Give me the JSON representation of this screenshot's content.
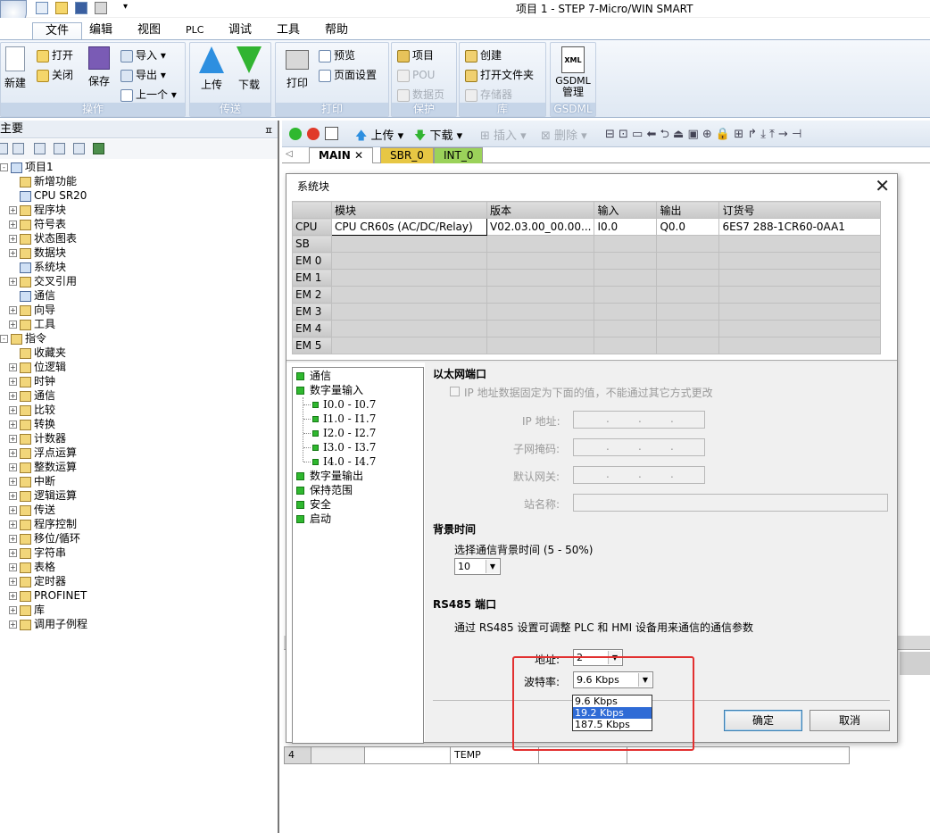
{
  "window": {
    "title": "项目 1 - STEP 7-Micro/WIN SMART"
  },
  "ribbon_tabs": [
    "文件",
    "编辑",
    "视图",
    "PLC",
    "调试",
    "工具",
    "帮助"
  ],
  "ribbon": {
    "ops": {
      "new": "新建",
      "open": "打开",
      "close": "关闭",
      "save": "保存",
      "import": "导入",
      "export": "导出",
      "prev": "上一个",
      "label": "操作"
    },
    "transfer": {
      "upload": "上传",
      "download": "下载",
      "label": "传送"
    },
    "print": {
      "print": "打印",
      "preview": "预览",
      "page_setup": "页面设置",
      "label": "打印"
    },
    "protect": {
      "project": "项目",
      "pou": "POU",
      "datapage": "数据页",
      "label": "保护"
    },
    "lib": {
      "create": "创建",
      "open_folder": "打开文件夹",
      "memory": "存储器",
      "label": "库"
    },
    "gsdml": {
      "line1": "GSDML",
      "line2": "管理",
      "label": "GSDML",
      "icon_text": "XML"
    }
  },
  "left_panel": {
    "title": "主要",
    "tree": [
      {
        "label": "项目1",
        "level": 0,
        "pm": "-"
      },
      {
        "label": "新增功能",
        "level": 1
      },
      {
        "label": "CPU SR20",
        "level": 1
      },
      {
        "label": "程序块",
        "level": 1,
        "pm": "+"
      },
      {
        "label": "符号表",
        "level": 1,
        "pm": "+"
      },
      {
        "label": "状态图表",
        "level": 1,
        "pm": "+"
      },
      {
        "label": "数据块",
        "level": 1,
        "pm": "+"
      },
      {
        "label": "系统块",
        "level": 1
      },
      {
        "label": "交叉引用",
        "level": 1,
        "pm": "+"
      },
      {
        "label": "通信",
        "level": 1
      },
      {
        "label": "向导",
        "level": 1,
        "pm": "+"
      },
      {
        "label": "工具",
        "level": 1,
        "pm": "+"
      },
      {
        "label": "指令",
        "level": 0,
        "pm": "-"
      },
      {
        "label": "收藏夹",
        "level": 1
      },
      {
        "label": "位逻辑",
        "level": 1,
        "pm": "+"
      },
      {
        "label": "时钟",
        "level": 1,
        "pm": "+"
      },
      {
        "label": "通信",
        "level": 1,
        "pm": "+"
      },
      {
        "label": "比较",
        "level": 1,
        "pm": "+"
      },
      {
        "label": "转换",
        "level": 1,
        "pm": "+"
      },
      {
        "label": "计数器",
        "level": 1,
        "pm": "+"
      },
      {
        "label": "浮点运算",
        "level": 1,
        "pm": "+"
      },
      {
        "label": "整数运算",
        "level": 1,
        "pm": "+"
      },
      {
        "label": "中断",
        "level": 1,
        "pm": "+"
      },
      {
        "label": "逻辑运算",
        "level": 1,
        "pm": "+"
      },
      {
        "label": "传送",
        "level": 1,
        "pm": "+"
      },
      {
        "label": "程序控制",
        "level": 1,
        "pm": "+"
      },
      {
        "label": "移位/循环",
        "level": 1,
        "pm": "+"
      },
      {
        "label": "字符串",
        "level": 1,
        "pm": "+"
      },
      {
        "label": "表格",
        "level": 1,
        "pm": "+"
      },
      {
        "label": "定时器",
        "level": 1,
        "pm": "+"
      },
      {
        "label": "PROFINET",
        "level": 1,
        "pm": "+"
      },
      {
        "label": "库",
        "level": 1,
        "pm": "+"
      },
      {
        "label": "调用子例程",
        "level": 1,
        "pm": "+"
      }
    ]
  },
  "editor": {
    "toolbar": {
      "upload": "上传",
      "download": "下载",
      "insert": "插入",
      "delete": "删除"
    },
    "tabs": [
      "MAIN",
      "SBR_0",
      "INT_0"
    ],
    "bg_row": {
      "num": "4",
      "name": "TEMP"
    }
  },
  "dialog": {
    "title": "系统块",
    "columns": [
      "模块",
      "版本",
      "输入",
      "输出",
      "订货号"
    ],
    "rows": [
      {
        "slot": "CPU",
        "module": "CPU CR60s (AC/DC/Relay)",
        "version": "V02.03.00_00.00...",
        "input": "I0.0",
        "output": "Q0.0",
        "order": "6ES7 288-1CR60-0AA1"
      },
      {
        "slot": "SB"
      },
      {
        "slot": "EM 0"
      },
      {
        "slot": "EM 1"
      },
      {
        "slot": "EM 2"
      },
      {
        "slot": "EM 3"
      },
      {
        "slot": "EM 4"
      },
      {
        "slot": "EM 5"
      }
    ],
    "nav": [
      {
        "label": "通信",
        "level": 0
      },
      {
        "label": "数字量输入",
        "level": 0
      },
      {
        "label": "I0.0 - I0.7",
        "level": 1
      },
      {
        "label": "I1.0 - I1.7",
        "level": 1
      },
      {
        "label": "I2.0 - I2.7",
        "level": 1
      },
      {
        "label": "I3.0 - I3.7",
        "level": 1
      },
      {
        "label": "I4.0 - I4.7",
        "level": 1
      },
      {
        "label": "数字量输出",
        "level": 0
      },
      {
        "label": "保持范围",
        "level": 0
      },
      {
        "label": "安全",
        "level": 0
      },
      {
        "label": "启动",
        "level": 0
      }
    ],
    "ethernet": {
      "title": "以太网端口",
      "fixed_ip": "IP 地址数据固定为下面的值，不能通过其它方式更改",
      "ip_label": "IP 地址:",
      "mask_label": "子网掩码:",
      "gw_label": "默认网关:",
      "station_label": "站名称:"
    },
    "background": {
      "title": "背景时间",
      "label": "选择通信背景时间 (5 - 50%)",
      "value": "10"
    },
    "rs485": {
      "title": "RS485 端口",
      "desc": "通过 RS485 设置可调整 PLC 和 HMI 设备用来通信的通信参数",
      "addr_label": "地址:",
      "addr_value": "2",
      "baud_label": "波特率:",
      "baud_value": "9.6 Kbps",
      "baud_options": [
        "9.6 Kbps",
        "19.2 Kbps",
        "187.5 Kbps"
      ],
      "highlighted_option": "19.2 Kbps"
    },
    "ok": "确定",
    "cancel": "取消"
  },
  "colors": {
    "accent": "#2f6bd6",
    "highlight_box": "#e23030",
    "ok_icon": "#2fb82f"
  }
}
